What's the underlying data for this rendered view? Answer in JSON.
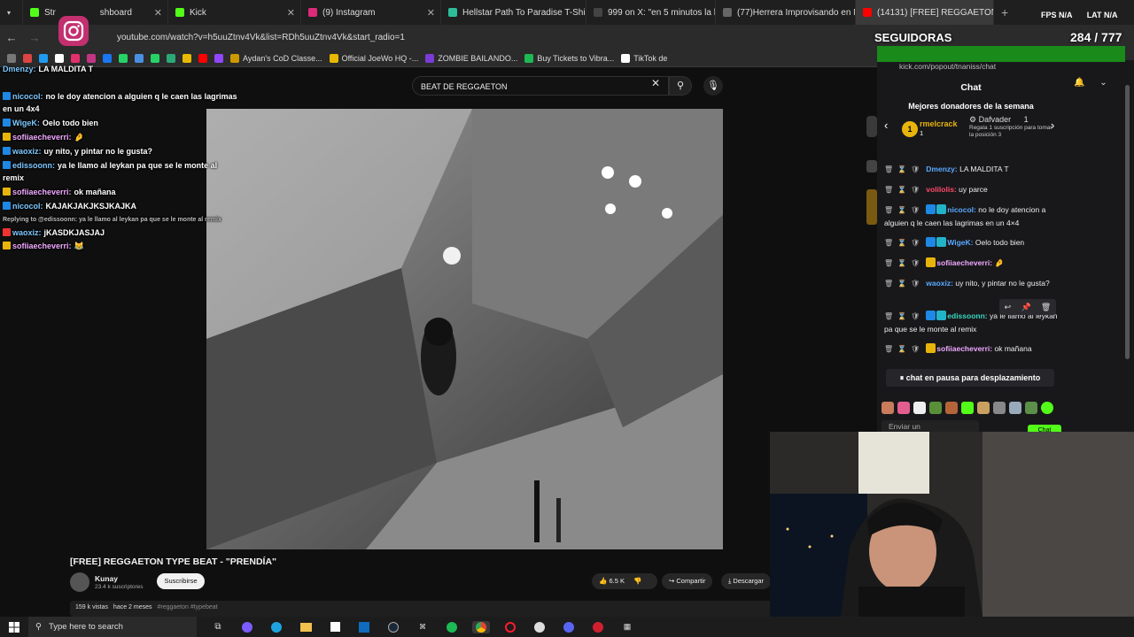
{
  "browser": {
    "tabs": [
      {
        "label": "Str",
        "color": "#53fc18"
      },
      {
        "label": "shboard",
        "color": "#53fc18"
      },
      {
        "label": "Kick",
        "color": "#53fc18"
      },
      {
        "label": "(9) Instagram",
        "color": "#dd2a7b"
      },
      {
        "label": "Hellstar Path To Paradise T-Shi",
        "color": "#2ebd9a"
      },
      {
        "label": "999 on X: \"en 5 minutos la hice",
        "color": "#ffffff"
      },
      {
        "label": "(77)Herrera Improvisando en M",
        "color": "#ffffff"
      },
      {
        "label": "(14131) [FREE] REGGAETON TY",
        "color": "#ff0000"
      }
    ],
    "url": "youtube.com/watch?v=h5uuZtnv4Vk&list=RDh5uuZtnv4Vk&start_radio=1",
    "bookmarks": [
      {
        "label": "Aydan's CoD Classe...",
        "color": "#cc9900"
      },
      {
        "label": "Official JoeWo HQ -...",
        "color": "#e8b900"
      },
      {
        "label": "ZOMBIE BAILANDO...",
        "color": "#7a3bd6"
      },
      {
        "label": "Buy Tickets to Vibra...",
        "color": "#1db954"
      },
      {
        "label": "TikTok de",
        "color": "#ffffff"
      }
    ]
  },
  "youtube": {
    "search_value": "BEAT DE REGGAETON",
    "video_title": "[FREE] REGGAETON TYPE BEAT - \"PRENDÍA\"",
    "channel_name": "Kunay",
    "channel_subs": "23.4 k suscriptores",
    "subscribe_label": "Suscribirse",
    "likes": "6.5 K",
    "share_label": "Compartir",
    "download_label": "Descargar",
    "desc_views": "159 k vistas",
    "desc_date": "hace 2 meses",
    "desc_tags": "#reggaeton #typebeat"
  },
  "overlay": {
    "chat_lines": [
      {
        "name": "Dmenzy:",
        "text": "LA MALDITA T",
        "color": "#7ec8ff"
      },
      {
        "name": "nicocol:",
        "text": "no le doy atencion a alguien q le caen las lagrimas",
        "color": "#7ec8ff"
      },
      {
        "name": "",
        "text": "en un 4x4",
        "color": "#ffffff"
      },
      {
        "name": "WigeK:",
        "text": "Oelo todo bien",
        "color": "#7ec8ff"
      },
      {
        "name": "sofiiaecheverri:",
        "text": "🤌",
        "color": "#f0a8ff"
      },
      {
        "name": "waoxiz:",
        "text": "uy nito, y pintar no le gusta?",
        "color": "#7ec8ff"
      },
      {
        "name": "edissoonn:",
        "text": "ya le llamo al leykan pa que se le monte al",
        "color": "#7ec8ff"
      },
      {
        "name": "",
        "text": "remix",
        "color": "#ffffff"
      },
      {
        "name": "sofiiaecheverri:",
        "text": "ok mañana",
        "color": "#f0a8ff"
      },
      {
        "name": "nicocol:",
        "text": "KAJAKJAKJKSJKAJKA",
        "color": "#7ec8ff"
      },
      {
        "name": "",
        "text": "Replying to @edissoonn: ya le llamo al leykan pa que se le monte al remix",
        "color": "#bbbbbb"
      },
      {
        "name": "waoxiz:",
        "text": "jKASDKJASJAJ",
        "color": "#7ec8ff"
      },
      {
        "name": "sofiiaecheverri:",
        "text": "😹",
        "color": "#f0a8ff"
      }
    ],
    "fps_text": "FPS N/A",
    "lat_text": "LAT N/A",
    "followers_label": "SEGUIDORAS",
    "followers_count": "284 / 777"
  },
  "kick": {
    "url": "kick.com/popout/tnaniss/chat",
    "header": "Chat",
    "donors_title": "Mejores donadores de la semana",
    "donor1_rank": "1",
    "donor1_name": "rmelcrack",
    "donor1_count": "1",
    "donor2_name": "Dafvader",
    "donor2_count": "1",
    "donor2_sub": "Regala 1 suscripción para tomar la posición 3",
    "messages": [
      {
        "name": "Dmenzy:",
        "text": "LA MALDITA T",
        "color": "#5aa9ff"
      },
      {
        "name": "volilolis:",
        "text": "uy parce",
        "color": "#ff4a6b"
      },
      {
        "name": "nicocol:",
        "text": "no le doy atencion a alguien q le caen las lagrimas en un 4×4",
        "color": "#5aa9ff"
      },
      {
        "name": "WigeK:",
        "text": "Oelo todo bien",
        "color": "#5aa9ff"
      },
      {
        "name": "sofiiaecheverri:",
        "text": "🤌",
        "color": "#f0a8ff"
      },
      {
        "name": "waoxiz:",
        "text": "uy nito, y pintar no le gusta?",
        "color": "#5aa9ff"
      },
      {
        "name": "edissoonn:",
        "text": "ya le llamo al leykan pa que se le monte al remix",
        "color": "#39d7c0"
      },
      {
        "name": "sofiiaecheverri:",
        "text": "ok mañana",
        "color": "#f0a8ff"
      }
    ],
    "paused_label": "chat en pausa para desplazamiento",
    "input_placeholder": "Enviar un",
    "send_label": "Chat"
  },
  "taskbar": {
    "search_placeholder": "Type here to search"
  }
}
